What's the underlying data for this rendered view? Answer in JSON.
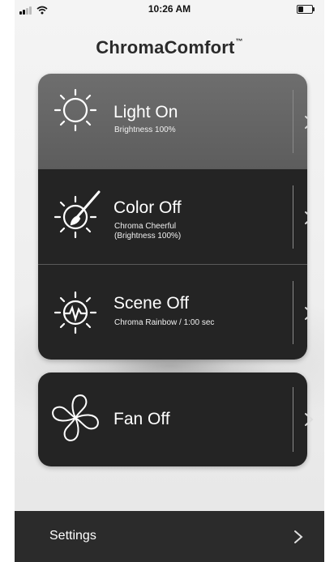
{
  "status_bar": {
    "time": "10:26 AM",
    "battery_level": 0.4
  },
  "app": {
    "title": "ChromaComfort",
    "trademark": "™"
  },
  "controls": [
    {
      "label": "Light On",
      "detail": "Brightness 100%",
      "icon": "sun-icon",
      "active": true
    },
    {
      "label": "Color Off",
      "detail": "Chroma Cheerful\n(Brightness 100%)",
      "icon": "color-brush-icon",
      "active": false
    },
    {
      "label": "Scene Off",
      "detail": "Chroma Rainbow / 1:00 sec",
      "icon": "scene-wave-icon",
      "active": false
    }
  ],
  "fan": {
    "label": "Fan Off",
    "icon": "fan-icon"
  },
  "settings": {
    "label": "Settings"
  },
  "colors": {
    "active_row": "#666666",
    "inactive_row": "#242424",
    "settings_bar": "#2b2b2b"
  }
}
